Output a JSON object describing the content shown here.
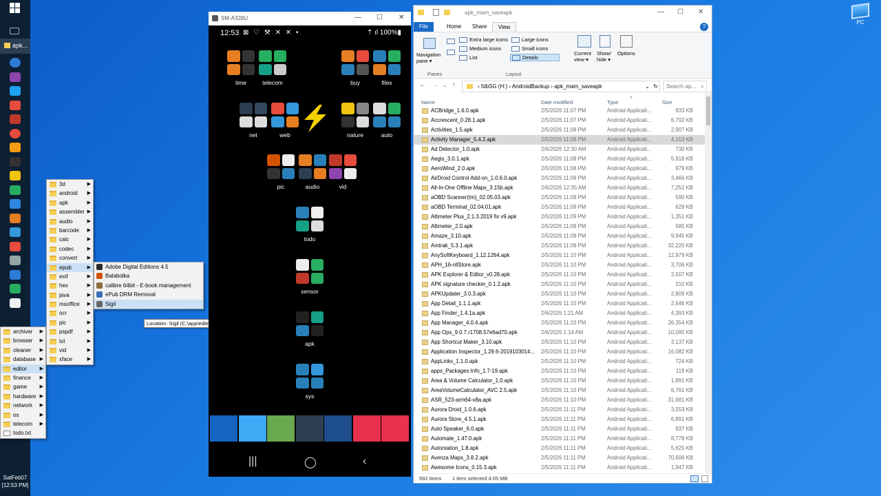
{
  "taskbar": {
    "active_item_label": "apk...",
    "clock_line1": "SatFeb07",
    "clock_line2": "[12:53 PM]",
    "icons": [
      "edge-icon",
      "podcast-icon",
      "telegram-icon",
      "barcode-icon",
      "opera-icon",
      "media-icon",
      "firefox-icon",
      "mask-icon",
      "gmail-icon",
      "star-icon",
      "compass-icon",
      "brave-icon",
      "chrome-icon",
      "colors-icon",
      "gear-icon",
      "edge-icon",
      "hangouts-icon",
      "document-icon"
    ]
  },
  "desktop": {
    "pc_label": "PC"
  },
  "menu_root": [
    {
      "label": "archiver",
      "sub": true
    },
    {
      "label": "browser",
      "sub": true
    },
    {
      "label": "cleaner",
      "sub": true
    },
    {
      "label": "database",
      "sub": true
    },
    {
      "label": "editor",
      "sub": true,
      "hl": true
    },
    {
      "label": "finance",
      "sub": true
    },
    {
      "label": "game",
      "sub": true
    },
    {
      "label": "hardware",
      "sub": true
    },
    {
      "label": "network",
      "sub": true
    },
    {
      "label": "os",
      "sub": true
    },
    {
      "label": "telecom",
      "sub": true
    },
    {
      "label": "todo.txt",
      "sub": false
    }
  ],
  "menu_editor": [
    {
      "label": "3d",
      "sub": true
    },
    {
      "label": "android",
      "sub": true
    },
    {
      "label": "apk",
      "sub": true
    },
    {
      "label": "assembler",
      "sub": true
    },
    {
      "label": "audio",
      "sub": true
    },
    {
      "label": "barcode",
      "sub": true
    },
    {
      "label": "calc",
      "sub": true
    },
    {
      "label": "codec",
      "sub": true
    },
    {
      "label": "convert",
      "sub": true
    },
    {
      "label": "epub",
      "sub": true,
      "hl": true
    },
    {
      "label": "exif",
      "sub": true
    },
    {
      "label": "hex",
      "sub": true
    },
    {
      "label": "java",
      "sub": true
    },
    {
      "label": "msoffice",
      "sub": true
    },
    {
      "label": "ocr",
      "sub": true
    },
    {
      "label": "pic",
      "sub": true
    },
    {
      "label": "pspdf",
      "sub": true
    },
    {
      "label": "txt",
      "sub": true
    },
    {
      "label": "vid",
      "sub": true
    },
    {
      "label": "xface",
      "sub": true
    }
  ],
  "menu_epub": [
    {
      "label": "Adobe Digital Editions 4.5",
      "color": "#2b2b2b"
    },
    {
      "label": "Balabolka",
      "color": "#d35400"
    },
    {
      "label": "calibre 64bit - E-book management",
      "color": "#8e6c3e"
    },
    {
      "label": "ePub DRM Removal",
      "color": "#3b6fb6"
    },
    {
      "label": "Sigil",
      "color": "#666666",
      "hl": true
    }
  ],
  "tooltip": "Location: Sigil (C:\\app\\editor\\epub\\sigil)",
  "phone": {
    "window_title": "SM-A328U",
    "time": "12:53",
    "indicators": "⊠ ♡ ⚒ ✕ ✕ •",
    "right_status": "⇡ ıl 100%▮",
    "folders": [
      {
        "label": "time",
        "colors": [
          "#e67e22",
          "#333",
          "#e67e22",
          "#333"
        ]
      },
      {
        "label": "telecom",
        "colors": [
          "#27ae60",
          "#27ae60",
          "#16a085",
          "#ccc"
        ]
      },
      {
        "label": "buy",
        "colors": [
          "#e67e22",
          "#e74c3c",
          "#2980b9",
          "#555"
        ]
      },
      {
        "label": "files",
        "colors": [
          "#2980b9",
          "#27ae60",
          "#e67e22",
          "#2980b9"
        ]
      },
      {
        "label": "net",
        "colors": [
          "#2c3e50",
          "#34495e",
          "#ddd",
          "#ddd"
        ]
      },
      {
        "label": "web",
        "colors": [
          "#e74c3c",
          "#3498db",
          "#3498db",
          "#e67e22"
        ]
      },
      {
        "label": "nature",
        "colors": [
          "#f1c40f",
          "#888",
          "#333",
          "#ddd"
        ]
      },
      {
        "label": "auto",
        "colors": [
          "#ddd",
          "#27ae60",
          "#2980b9",
          "#2980b9"
        ]
      },
      {
        "label": "pic",
        "colors": [
          "#d35400",
          "#eee",
          "#333",
          "#2980b9"
        ]
      },
      {
        "label": "audio",
        "colors": [
          "#e67e22",
          "#2980b9",
          "#2c3e50",
          "#e67e22"
        ]
      },
      {
        "label": "vid",
        "colors": [
          "#c0392b",
          "#e74c3c",
          "#8e44ad",
          "#eee"
        ]
      },
      {
        "label": "todo",
        "colors": [
          "#2980b9",
          "#eee",
          "#16a085",
          "#ddd"
        ]
      },
      {
        "label": "sensor",
        "colors": [
          "#eee",
          "#27ae60",
          "#c0392b",
          "#27ae60"
        ]
      },
      {
        "label": "apk",
        "colors": [
          "#222",
          "#16a085",
          "#2980b9",
          "#222"
        ]
      },
      {
        "label": "sys",
        "colors": [
          "#2980b9",
          "#3498db",
          "#2980b9",
          "#2980b9"
        ]
      }
    ],
    "dock": [
      {
        "name": "messages-icon",
        "color": "#1565c0"
      },
      {
        "name": "phone-icon",
        "color": "#3fa9f5"
      },
      {
        "name": "clock-icon",
        "color": "#6aa84f"
      },
      {
        "name": "settings-icon",
        "color": "#2f3f52"
      },
      {
        "name": "apps-folder-icon",
        "color": "#1e4e8c"
      },
      {
        "name": "voice-recorder-icon",
        "color": "#e8314d"
      },
      {
        "name": "camera-icon",
        "color": "#e8314d"
      }
    ]
  },
  "explorer": {
    "window_title": "apk_mam_saveapk",
    "tabs": {
      "file": "File",
      "home": "Home",
      "share": "Share",
      "view": "View"
    },
    "ribbon": {
      "nav_pane": "Navigation pane ▾",
      "panes_group": "Panes",
      "layout_group": "Layout",
      "layouts": [
        "Extra large icons",
        "Large icons",
        "Medium icons",
        "Small icons",
        "List",
        "Details"
      ],
      "current_view": "Current view ▾",
      "show_hide": "Show/ hide ▾",
      "options": "Options"
    },
    "path": [
      "5tbSG (H:)",
      "AndroidBackup",
      "apk_mam_saveapk"
    ],
    "search_placeholder": "Search ap...",
    "columns": {
      "name": "Name",
      "date": "Date modified",
      "type": "Type",
      "size": "Size"
    },
    "files": [
      [
        "ACBridge_1.6.0.apk",
        "2/5/2026 11:07 PM",
        "933 KB"
      ],
      [
        "Accrescent_0.28.1.apk",
        "2/5/2026 11:07 PM",
        "6,792 KB"
      ],
      [
        "Activities_1.5.apk",
        "2/5/2026 11:08 PM",
        "2,907 KB"
      ],
      [
        "Activity Manager_5.4.2.apk",
        "2/5/2026 11:08 PM",
        "4,153 KB"
      ],
      [
        "Ad Detector_1.0.apk",
        "2/6/2026 12:30 AM",
        "730 KB"
      ],
      [
        "Aegis_3.0.1.apk",
        "2/5/2026 11:08 PM",
        "5,918 KB"
      ],
      [
        "AeroWind_2.0.apk",
        "2/5/2026 11:08 PM",
        "979 KB"
      ],
      [
        "AirDroid Control Add-on_1.0.6.0.apk",
        "2/5/2026 11:09 PM",
        "3,466 KB"
      ],
      [
        "All-In-One Offline Maps_3.15b.apk",
        "2/6/2026 12:35 AM",
        "7,252 KB"
      ],
      [
        "aOBD Scanner(tm)_02.05.03.apk",
        "2/5/2026 11:09 PM",
        "590 KB"
      ],
      [
        "aOBD Terminal_02.04.01.apk",
        "2/5/2026 11:09 PM",
        "629 KB"
      ],
      [
        "Altimeter Plus_2.1.3.2019 fix v9.apk",
        "2/5/2026 11:09 PM",
        "1,351 KB"
      ],
      [
        "Altimeter_2.0.apk",
        "2/5/2026 11:09 PM",
        "585 KB"
      ],
      [
        "Amaze_3.10.apk",
        "2/5/2026 11:09 PM",
        "9,945 KB"
      ],
      [
        "Amtrak_5.3.1.apk",
        "2/5/2026 11:09 PM",
        "32,220 KB"
      ],
      [
        "AnySoftKeyboard_1.12.1264.apk",
        "2/5/2026 11:10 PM",
        "12,979 KB"
      ],
      [
        "APH_16-nllStore.apk",
        "2/5/2026 11:10 PM",
        "3,706 KB"
      ],
      [
        "APK Explorer & Editor_v0.28.apk",
        "2/5/2026 11:10 PM",
        "3,507 KB"
      ],
      [
        "APK signature checker_0.1.2.apk",
        "2/5/2026 11:10 PM",
        "210 KB"
      ],
      [
        "APKUpdater_3.0.3.apk",
        "2/5/2026 11:10 PM",
        "2,809 KB"
      ],
      [
        "App Detail_1.1.1.apk",
        "2/5/2026 11:10 PM",
        "2,646 KB"
      ],
      [
        "App Finder_1.4.1a.apk",
        "2/6/2026 1:21 AM",
        "4,393 KB"
      ],
      [
        "App Manager_4.0.4.apk",
        "2/5/2026 11:10 PM",
        "26,354 KB"
      ],
      [
        "App Ops_9.0.7.r1708.57e6ad70.apk",
        "2/6/2026 1:14 AM",
        "10,095 KB"
      ],
      [
        "App Shortcut Maker_3.10.apk",
        "2/5/2026 11:10 PM",
        "3,137 KB"
      ],
      [
        "Application Inspector_1.29.6-2019103014...",
        "2/5/2026 11:10 PM",
        "16,082 KB"
      ],
      [
        "AppLinks_1.1.0.apk",
        "2/5/2026 11:10 PM",
        "724 KB"
      ],
      [
        "apps_Packages Info_1.7-19.apk",
        "2/5/2026 11:10 PM",
        "119 KB"
      ],
      [
        "Area & Volume Calculator_1.0.apk",
        "2/5/2026 11:10 PM",
        "1,891 KB"
      ],
      [
        "AreaVolumeCalculator_AVC 2.5.apk",
        "2/5/2026 11:10 PM",
        "6,761 KB"
      ],
      [
        "ASR_523-arm64-v8a.apk",
        "2/5/2026 11:10 PM",
        "31,681 KB"
      ],
      [
        "Aurora Droid_1.0.6.apk",
        "2/5/2026 11:11 PM",
        "3,553 KB"
      ],
      [
        "Aurora Store_4.5.1.apk",
        "2/5/2026 11:11 PM",
        "6,891 KB"
      ],
      [
        "Auto Speaker_6.0.apk",
        "2/5/2026 11:11 PM",
        "937 KB"
      ],
      [
        "Automate_1.47.0.apk",
        "2/5/2026 11:11 PM",
        "8,778 KB"
      ],
      [
        "Automation_1.8.apk",
        "2/5/2026 11:11 PM",
        "5,625 KB"
      ],
      [
        "Avenza Maps_3.8.2.apk",
        "2/5/2026 11:11 PM",
        "70,606 KB"
      ],
      [
        "Awesome Icons_0.15.3.apk",
        "2/5/2026 11:11 PM",
        "1,947 KB"
      ]
    ],
    "file_type": "Android Applicati...",
    "selected_row": 3,
    "status_count": "592 items",
    "status_sel": "1 item selected  4.05 MB"
  }
}
